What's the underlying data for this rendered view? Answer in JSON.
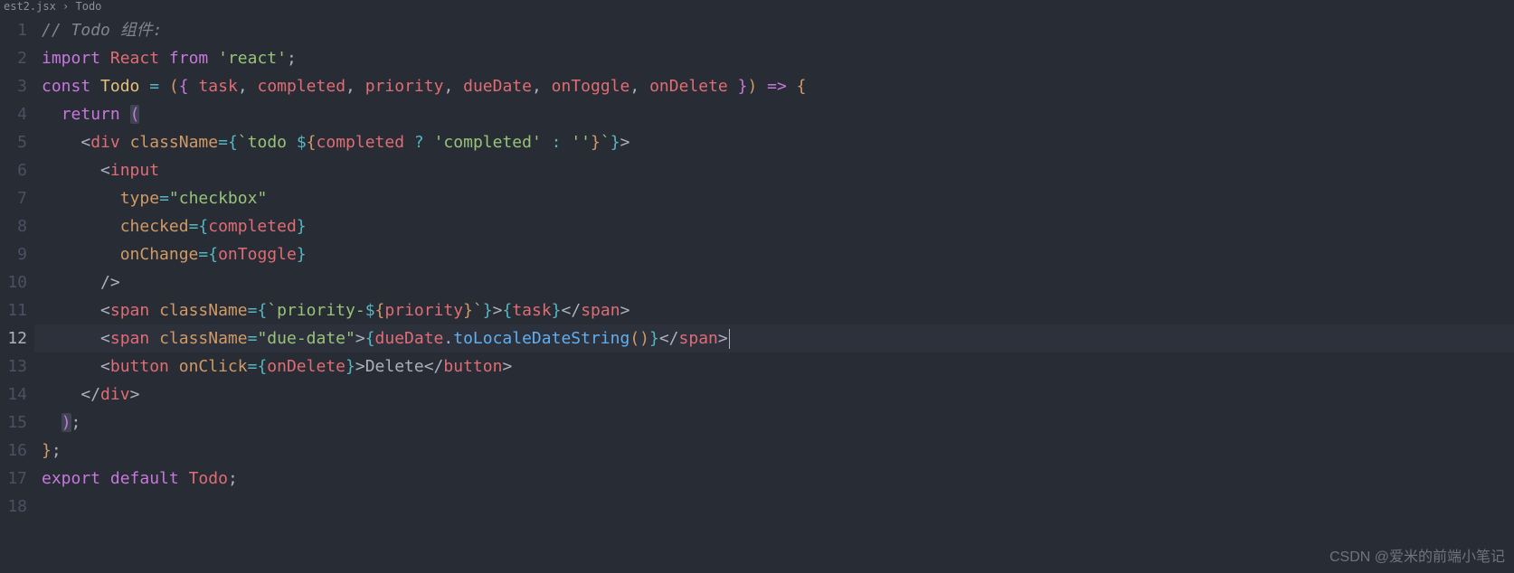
{
  "breadcrumb": {
    "file": "est2.jsx",
    "sep": "›",
    "symbol": "Todo"
  },
  "gutter": {
    "lines": [
      "1",
      "2",
      "3",
      "4",
      "5",
      "6",
      "7",
      "8",
      "9",
      "10",
      "11",
      "12",
      "13",
      "14",
      "15",
      "16",
      "17",
      "18"
    ],
    "active_line": 12
  },
  "code": {
    "l1": {
      "comment": "// Todo 组件:"
    },
    "l2": {
      "kw_import": "import",
      "name": "React",
      "kw_from": "from",
      "str": "'react'",
      "semi": ";"
    },
    "l3": {
      "kw_const": "const",
      "def": "Todo",
      "eq": "=",
      "lp_y": "(",
      "lb_m": "{",
      "p1": "task",
      "c1": ",",
      "p2": "completed",
      "c2": ",",
      "p3": "priority",
      "c3": ",",
      "p4": "dueDate",
      "c4": ",",
      "p5": "onToggle",
      "c5": ",",
      "p6": "onDelete",
      "rb_m": "}",
      "rp_y": ")",
      "arrow": "=>",
      "lb_y": "{"
    },
    "l4": {
      "kw_return": "return",
      "lp_m": "("
    },
    "l5": {
      "lt": "<",
      "tag": "div",
      "sp": " ",
      "attr": "className",
      "eq": "=",
      "lb_c": "{",
      "bt1": "`",
      "s1": "todo ",
      "dol": "$",
      "lb_y": "{",
      "var": "completed",
      "q": "?",
      "s2": "'completed'",
      "colon": ":",
      "s3": "''",
      "rb_y": "}",
      "bt2": "`",
      "rb_c": "}",
      "gt": ">"
    },
    "l6": {
      "lt": "<",
      "tag": "input"
    },
    "l7": {
      "attr": "type",
      "eq": "=",
      "str": "\"checkbox\""
    },
    "l8": {
      "attr": "checked",
      "eq": "=",
      "lb": "{",
      "var": "completed",
      "rb": "}"
    },
    "l9": {
      "attr": "onChange",
      "eq": "=",
      "lb": "{",
      "var": "onToggle",
      "rb": "}"
    },
    "l10": {
      "close": "/>"
    },
    "l11": {
      "lt": "<",
      "tag": "span",
      "sp": " ",
      "attr": "className",
      "eq": "=",
      "lb_c": "{",
      "bt1": "`",
      "s1": "priority-",
      "dol": "$",
      "lb_y": "{",
      "var": "priority",
      "rb_y": "}",
      "bt2": "`",
      "rb_c": "}",
      "gt": ">",
      "lb2": "{",
      "var2": "task",
      "rb2": "}",
      "lt2": "</",
      "tag2": "span",
      "gt2": ">"
    },
    "l12": {
      "lt": "<",
      "tag": "span",
      "sp": " ",
      "attr": "className",
      "eq": "=",
      "str": "\"due-date\"",
      "gt": ">",
      "lb": "{",
      "obj": "dueDate",
      "dot": ".",
      "fn": "toLocaleDateString",
      "lp": "(",
      ")": ")",
      "rb": "}",
      "lt2": "</",
      "tag2": "span",
      "gt2": ">"
    },
    "l13": {
      "lt": "<",
      "tag": "button",
      "sp": " ",
      "attr": "onClick",
      "eq": "=",
      "lb": "{",
      "var": "onDelete",
      "rb": "}",
      "gt": ">",
      "text": "Delete",
      "lt2": "</",
      "tag2": "button",
      "gt2": ">"
    },
    "l14": {
      "lt": "</",
      "tag": "div",
      "gt": ">"
    },
    "l15": {
      "rp_m": ")",
      "semi": ";"
    },
    "l16": {
      "rb_y": "}",
      "semi": ";"
    },
    "l17": {
      "kw_export": "export",
      "kw_default": "default",
      "name": "Todo",
      "semi": ";"
    }
  },
  "watermark": "CSDN @爱米的前端小笔记"
}
